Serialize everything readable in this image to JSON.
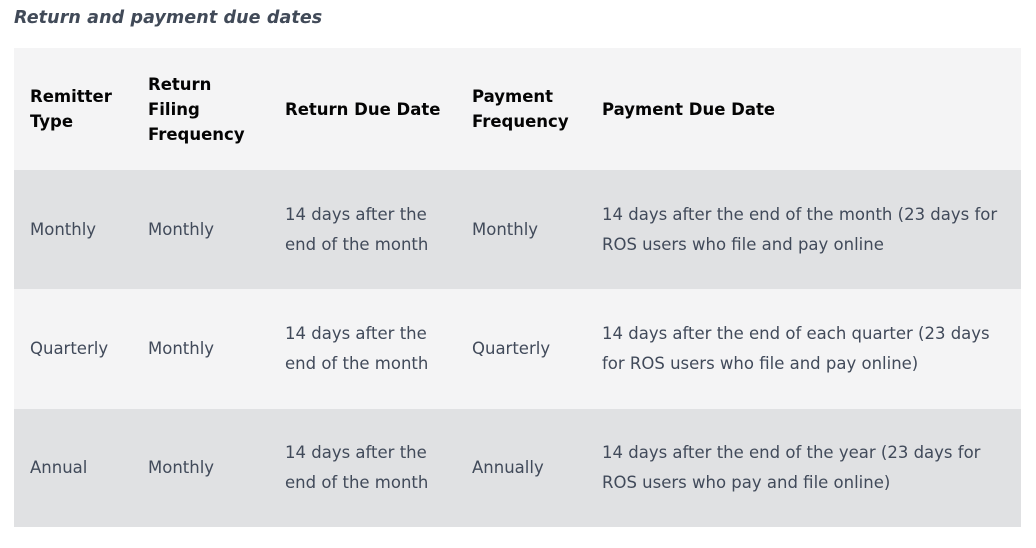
{
  "caption": "Return and payment due dates",
  "table": {
    "headers": [
      "Remitter Type",
      "Return Filing Frequency",
      "Return Due Date",
      "Payment Frequency",
      "Payment Due Date"
    ],
    "rows": [
      {
        "remitter_type": "Monthly",
        "return_filing_frequency": "Monthly",
        "return_due_date": "14 days after the end of the month",
        "payment_frequency": "Monthly",
        "payment_due_date": "14 days after the end of the month (23 days for ROS users who file and pay online"
      },
      {
        "remitter_type": "Quarterly",
        "return_filing_frequency": "Monthly",
        "return_due_date": "14 days after the end of the month",
        "payment_frequency": "Quarterly",
        "payment_due_date": "14 days after the end of each quarter (23 days for ROS users who file and pay online)"
      },
      {
        "remitter_type": "Annual",
        "return_filing_frequency": "Monthly",
        "return_due_date": "14 days after the end of the month",
        "payment_frequency": "Annually",
        "payment_due_date": "14 days after the end of the year (23 days for ROS users who pay and file online)"
      }
    ]
  },
  "colors": {
    "caption_text": "#414a58",
    "header_bg": "#f4f4f5",
    "header_text": "#040404",
    "row_odd_bg": "#e0e1e3",
    "row_even_bg": "#f4f4f5",
    "body_text": "#414a5a",
    "page_bg": "#ffffff"
  }
}
